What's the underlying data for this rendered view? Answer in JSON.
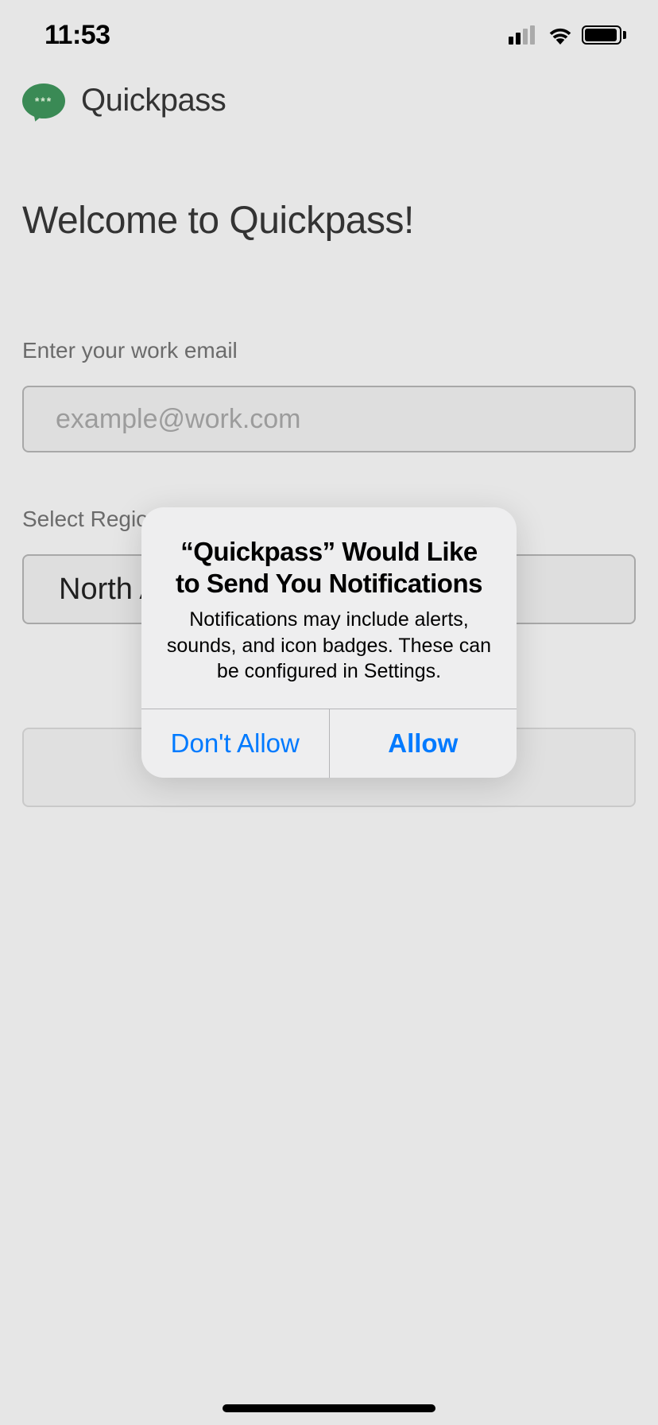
{
  "statusBar": {
    "time": "11:53"
  },
  "app": {
    "name": "Quickpass",
    "logoGlyph": "***"
  },
  "welcome": {
    "title": "Welcome to Quickpass!"
  },
  "emailField": {
    "label": "Enter your work email",
    "placeholder": "example@work.com",
    "value": ""
  },
  "regionField": {
    "label": "Select Region",
    "selected": "North America"
  },
  "submit": {
    "label": ""
  },
  "alert": {
    "title": "“Quickpass” Would Like to Send You Notifications",
    "message": "Notifications may include alerts, sounds, and icon badges. These can be configured in Settings.",
    "dontAllow": "Don't Allow",
    "allow": "Allow"
  }
}
